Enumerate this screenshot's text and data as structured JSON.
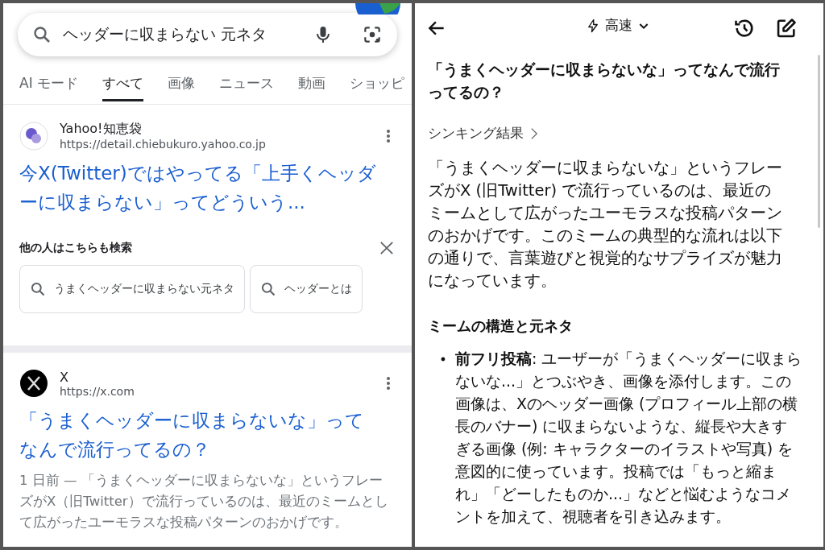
{
  "search_panel": {
    "search_field": {
      "value": "ヘッダーに収まらない 元ネタ"
    },
    "tabs": [
      {
        "label": "AI モード",
        "selected": false
      },
      {
        "label": "すべて",
        "selected": true
      },
      {
        "label": "画像",
        "selected": false
      },
      {
        "label": "ニュース",
        "selected": false
      },
      {
        "label": "動画",
        "selected": false
      },
      {
        "label": "ショッピ",
        "selected": false
      }
    ],
    "blocks": [
      {
        "kind": "qa",
        "site": "Yahoo!知恵袋",
        "url": "https://detail.chiebukuro.yahoo.co.jp",
        "title": "今X(Twitter)ではやってる「上手くヘッダーに収まらない」ってどういう..."
      },
      {
        "kind": "related",
        "heading": "他の人はこちらも検索",
        "chips": [
          "うまくヘッダーに収まらない元ネタ",
          "ヘッダーとは"
        ]
      },
      {
        "kind": "x",
        "site": "X",
        "url": "https://x.com",
        "title": "「うまくヘッダーに収まらないな」ってなんで流行ってるの？",
        "snippet": "1 日前 — 「うまくヘッダーに収まらないな」というフレーズがX（旧Twitter）で流行っているのは、最近のミームとして広がったユーモラスな投稿パターンのおかげです。"
      }
    ]
  },
  "chat_panel": {
    "mode": "高速",
    "question": "「うまくヘッダーに収まらないな」ってなんで流行ってるの？",
    "thinking_link": "シンキング結果",
    "answer": "「うまくヘッダーに収まらないな」というフレーズがX (旧Twitter) で流行っているのは、最近のミームとして広がったユーモラスな投稿パターンのおかげです。このミームの典型的な流れは以下の通りで、言葉遊びと視覚的なサプライズが魅力になっています。",
    "section_heading": "ミームの構造と元ネタ",
    "bullets": [
      "**前フリ投稿**: ユーザーが「うまくヘッダーに収まらないな...」とつぶやき、画像を添付します。この画像は、Xのヘッダー画像 (プロフィール上部の横長のバナー) に収まらないような、縦長や大きすぎる画像 (例: キャラクターのイラストや写真) を意図的に使っています。投稿では「もっと縮まれ」「どーしたものか...」などと悩むようなコメントを加えて、視聴者を引き込みます。"
    ]
  }
}
